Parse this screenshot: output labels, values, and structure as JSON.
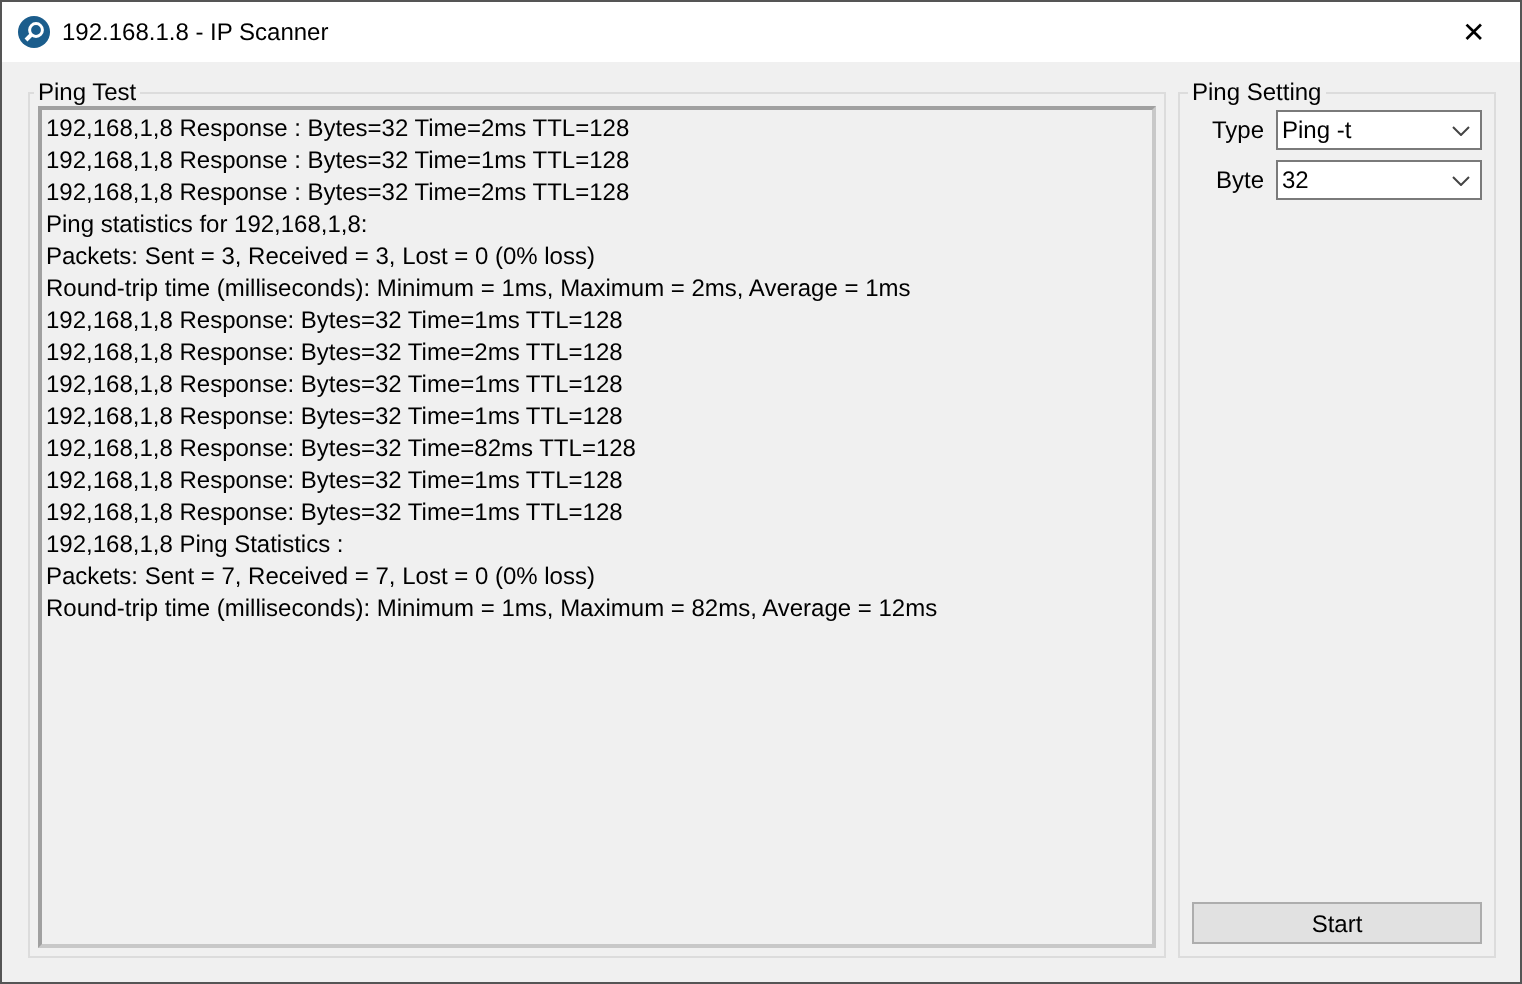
{
  "window": {
    "title": "192.168.1.8 - IP Scanner",
    "close": "✕"
  },
  "ping_test": {
    "title": "Ping Test",
    "lines": [
      "192,168,1,8 Response : Bytes=32 Time=2ms TTL=128",
      "192,168,1,8 Response : Bytes=32 Time=1ms TTL=128",
      "192,168,1,8 Response : Bytes=32 Time=2ms TTL=128",
      "Ping statistics for 192,168,1,8:",
      "Packets: Sent = 3, Received = 3, Lost = 0 (0% loss)",
      "Round-trip time (milliseconds): Minimum = 1ms, Maximum = 2ms, Average = 1ms",
      "192,168,1,8 Response: Bytes=32 Time=1ms TTL=128",
      "192,168,1,8 Response: Bytes=32 Time=2ms TTL=128",
      "192,168,1,8 Response: Bytes=32 Time=1ms TTL=128",
      "192,168,1,8 Response: Bytes=32 Time=1ms TTL=128",
      "192,168,1,8 Response: Bytes=32 Time=82ms TTL=128",
      "192,168,1,8 Response: Bytes=32 Time=1ms TTL=128",
      "192,168,1,8 Response: Bytes=32 Time=1ms TTL=128",
      "192,168,1,8 Ping Statistics :",
      "Packets: Sent = 7, Received = 7, Lost = 0 (0% loss)",
      "Round-trip time (milliseconds): Minimum = 1ms, Maximum = 82ms, Average = 12ms"
    ]
  },
  "ping_setting": {
    "title": "Ping Setting",
    "fields": [
      {
        "label": "Type",
        "value": "Ping -t"
      },
      {
        "label": "Byte",
        "value": "32"
      }
    ],
    "button": "Start"
  }
}
